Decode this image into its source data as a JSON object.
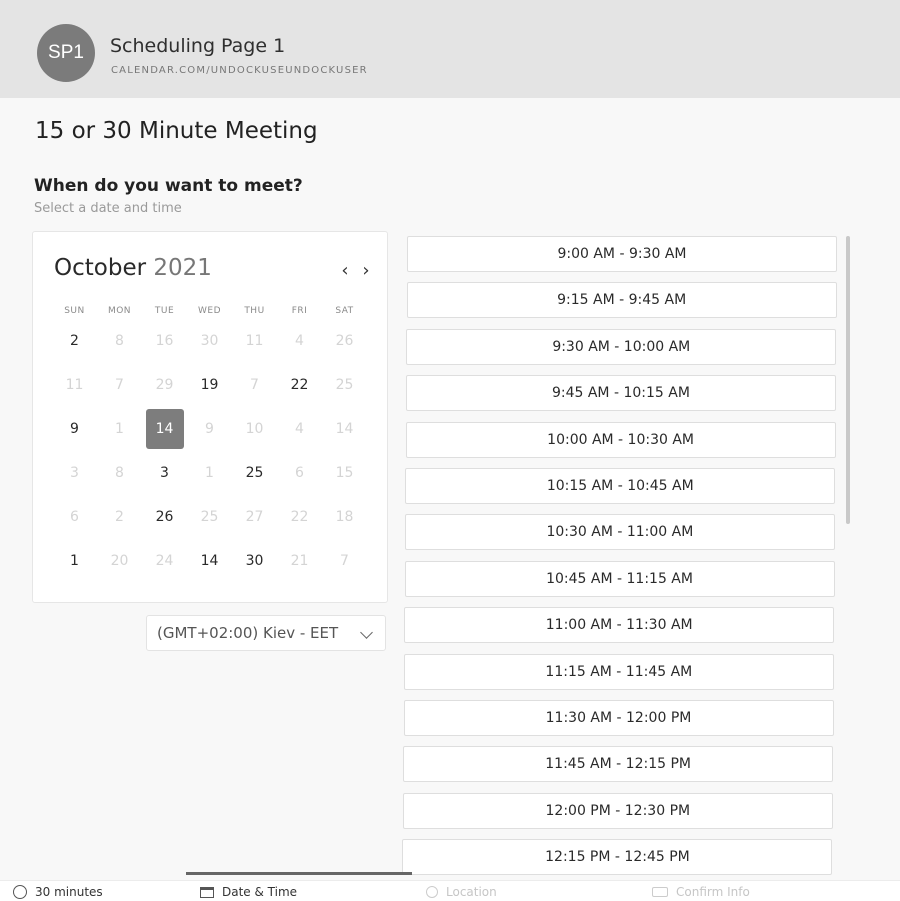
{
  "header": {
    "avatar_initials": "SP1",
    "page_name": "Scheduling Page 1",
    "page_url": "CALENDAR.COM/UNDOCKUSEUNDOCKUSER"
  },
  "meeting": {
    "title": "15 or 30 Minute Meeting",
    "question": "When do you want to meet?",
    "subtitle": "Select a date and time"
  },
  "calendar": {
    "month": "October",
    "year": "2021",
    "prev_icon": "chevron-left-icon",
    "next_icon": "chevron-right-icon",
    "prev_glyph": "‹",
    "next_glyph": "›",
    "weekdays": [
      "SUN",
      "MON",
      "TUE",
      "WED",
      "THU",
      "FRI",
      "SAT"
    ],
    "weeks": [
      [
        {
          "d": "2",
          "s": "available"
        },
        {
          "d": "8",
          "s": "disabled"
        },
        {
          "d": "16",
          "s": "disabled"
        },
        {
          "d": "30",
          "s": "disabled"
        },
        {
          "d": "11",
          "s": "disabled"
        },
        {
          "d": "4",
          "s": "disabled"
        },
        {
          "d": "26",
          "s": "disabled"
        }
      ],
      [
        {
          "d": "11",
          "s": "disabled"
        },
        {
          "d": "7",
          "s": "disabled"
        },
        {
          "d": "29",
          "s": "disabled"
        },
        {
          "d": "19",
          "s": "available"
        },
        {
          "d": "7",
          "s": "disabled"
        },
        {
          "d": "22",
          "s": "available"
        },
        {
          "d": "25",
          "s": "disabled"
        }
      ],
      [
        {
          "d": "9",
          "s": "available"
        },
        {
          "d": "1",
          "s": "disabled"
        },
        {
          "d": "14",
          "s": "selected"
        },
        {
          "d": "9",
          "s": "disabled"
        },
        {
          "d": "10",
          "s": "disabled"
        },
        {
          "d": "4",
          "s": "disabled"
        },
        {
          "d": "14",
          "s": "disabled"
        }
      ],
      [
        {
          "d": "3",
          "s": "disabled"
        },
        {
          "d": "8",
          "s": "disabled"
        },
        {
          "d": "3",
          "s": "available"
        },
        {
          "d": "1",
          "s": "disabled"
        },
        {
          "d": "25",
          "s": "available"
        },
        {
          "d": "6",
          "s": "disabled"
        },
        {
          "d": "15",
          "s": "disabled"
        }
      ],
      [
        {
          "d": "6",
          "s": "disabled"
        },
        {
          "d": "2",
          "s": "disabled"
        },
        {
          "d": "26",
          "s": "available"
        },
        {
          "d": "25",
          "s": "disabled"
        },
        {
          "d": "27",
          "s": "disabled"
        },
        {
          "d": "22",
          "s": "disabled"
        },
        {
          "d": "18",
          "s": "disabled"
        }
      ],
      [
        {
          "d": "1",
          "s": "available"
        },
        {
          "d": "20",
          "s": "disabled"
        },
        {
          "d": "24",
          "s": "disabled"
        },
        {
          "d": "14",
          "s": "available"
        },
        {
          "d": "30",
          "s": "available"
        },
        {
          "d": "21",
          "s": "disabled"
        },
        {
          "d": "7",
          "s": "disabled"
        }
      ]
    ]
  },
  "timezone": {
    "label": "(GMT+02:00) Kiev - EET",
    "icon": "chevron-down-icon"
  },
  "time_slots": [
    "9:00 AM - 9:30 AM",
    "9:15 AM - 9:45 AM",
    "9:30 AM - 10:00 AM",
    "9:45 AM - 10:15 AM",
    "10:00 AM - 10:30 AM",
    "10:15 AM - 10:45 AM",
    "10:30 AM - 11:00 AM",
    "10:45 AM - 11:15 AM",
    "11:00 AM - 11:30 AM",
    "11:15 AM - 11:45 AM",
    "11:30 AM - 12:00 PM",
    "11:45 AM - 12:15 PM",
    "12:00 PM - 12:30 PM",
    "12:15 PM - 12:45 PM"
  ],
  "bottom_nav": [
    {
      "label": "30 minutes",
      "icon": "clock-icon",
      "state": "done"
    },
    {
      "label": "Date & Time",
      "icon": "calendar-icon",
      "state": "active"
    },
    {
      "label": "Location",
      "icon": "location-pin-icon",
      "state": "upcoming"
    },
    {
      "label": "Confirm Info",
      "icon": "info-card-icon",
      "state": "upcoming"
    }
  ],
  "colors": {
    "header_bg": "#e4e4e4",
    "avatar_bg": "#7b7b7b",
    "selected_day": "#7d7d7d"
  }
}
